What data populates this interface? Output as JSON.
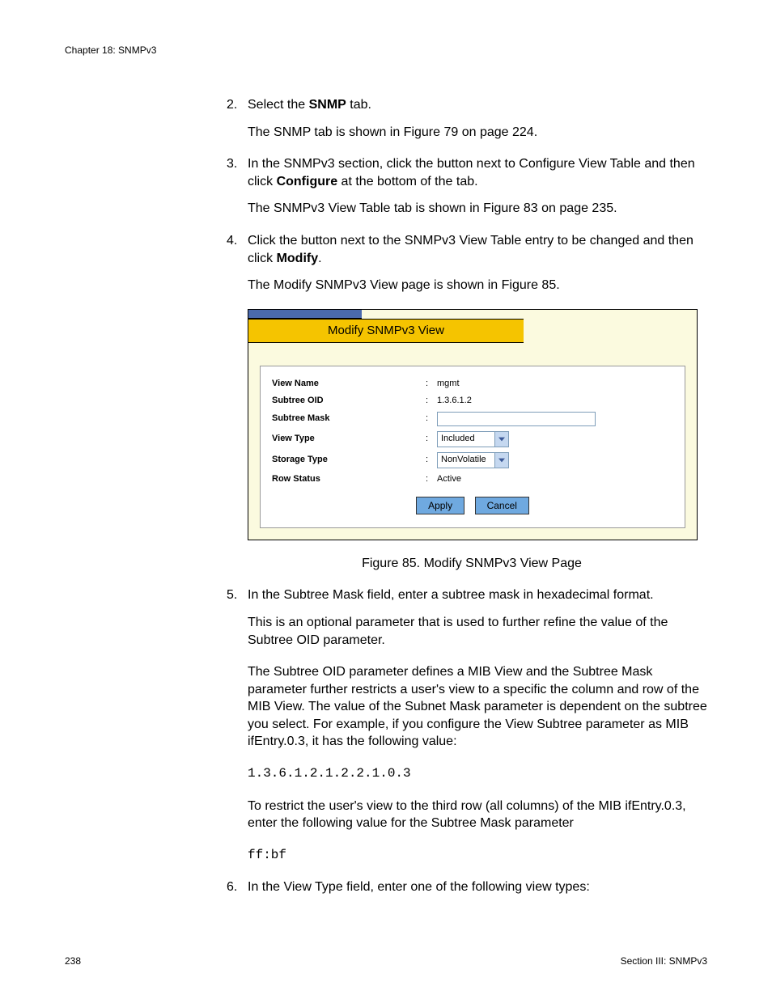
{
  "header": {
    "chapter": "Chapter 18: SNMPv3"
  },
  "steps": {
    "s2": {
      "num": "2.",
      "pre": "Select the ",
      "bold": "SNMP",
      "post": " tab.",
      "after": "The SNMP tab is shown in Figure 79 on page 224."
    },
    "s3": {
      "num": "3.",
      "pre": "In the SNMPv3 section, click the button next to Configure View Table and then click ",
      "bold": "Configure",
      "post": " at the bottom of the tab.",
      "after": "The SNMPv3 View Table tab is shown in Figure 83 on page 235."
    },
    "s4": {
      "num": "4.",
      "pre": "Click the button next to the SNMPv3 View Table entry to be changed and then click ",
      "bold": "Modify",
      "post": ".",
      "after": "The Modify SNMPv3 View page is shown in Figure 85."
    },
    "s5": {
      "num": "5.",
      "text": "In the Subtree Mask field, enter a subtree mask in hexadecimal format.",
      "p1": "This is an optional parameter that is used to further refine the value of the Subtree OID parameter.",
      "p2": "The Subtree OID parameter defines a MIB View and the Subtree Mask parameter further restricts a user's view to a specific the column and row of the MIB View. The value of the Subnet Mask parameter is dependent on the subtree you select. For example, if you configure the View Subtree parameter as MIB ifEntry.0.3, it has the following value:",
      "code1": "1.3.6.1.2.1.2.2.1.0.3",
      "p3": "To restrict the user's view to the third row (all columns) of the MIB ifEntry.0.3, enter the following value for the Subtree Mask parameter",
      "code2": "ff:bf"
    },
    "s6": {
      "num": "6.",
      "text": "In the View Type field, enter one of the following view types:"
    }
  },
  "figure": {
    "title": "Modify SNMPv3 View",
    "caption": "Figure 85. Modify SNMPv3 View Page",
    "rows": {
      "view_name": {
        "label": "View Name",
        "value": "mgmt"
      },
      "subtree_oid": {
        "label": "Subtree OID",
        "value": "1.3.6.1.2"
      },
      "subtree_mask": {
        "label": "Subtree Mask",
        "value": ""
      },
      "view_type": {
        "label": "View Type",
        "value": "Included"
      },
      "storage_type": {
        "label": "Storage Type",
        "value": "NonVolatile"
      },
      "row_status": {
        "label": "Row Status",
        "value": "Active"
      }
    },
    "buttons": {
      "apply": "Apply",
      "cancel": "Cancel"
    }
  },
  "footer": {
    "page": "238",
    "section": "Section III: SNMPv3"
  }
}
